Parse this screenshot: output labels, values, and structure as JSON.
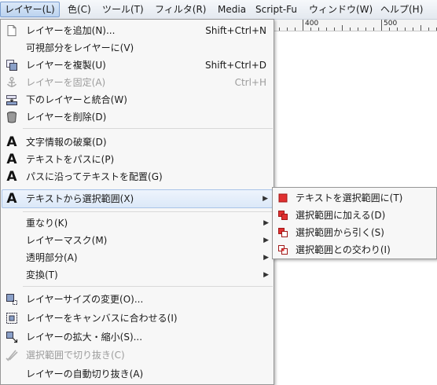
{
  "menubar": {
    "items": [
      {
        "label": "レイヤー(L)",
        "active": true
      },
      {
        "label": "色(C)"
      },
      {
        "label": "ツール(T)"
      },
      {
        "label": "フィルタ(R)"
      },
      {
        "label": "Media"
      },
      {
        "label": "Script-Fu"
      },
      {
        "label": "ウィンドウ(W)"
      },
      {
        "label": "ヘルプ(H)"
      }
    ]
  },
  "ruler": {
    "labels": [
      "400",
      "500"
    ]
  },
  "layer_menu": {
    "items": [
      {
        "label": "レイヤーを追加(N)...",
        "shortcut": "Shift+Ctrl+N",
        "icon": "new-layer-icon"
      },
      {
        "label": "可視部分をレイヤーに(V)"
      },
      {
        "label": "レイヤーを複製(U)",
        "shortcut": "Shift+Ctrl+D",
        "icon": "duplicate-layer-icon"
      },
      {
        "label": "レイヤーを固定(A)",
        "shortcut": "Ctrl+H",
        "icon": "anchor-icon",
        "disabled": true
      },
      {
        "label": "下のレイヤーと統合(W)",
        "icon": "merge-down-icon"
      },
      {
        "label": "レイヤーを削除(D)",
        "icon": "trash-icon"
      },
      {
        "label": "文字情報の破棄(D)",
        "icon": "text-tool-icon"
      },
      {
        "label": "テキストをパスに(P)",
        "icon": "text-tool-icon"
      },
      {
        "label": "パスに沿ってテキストを配置(G)",
        "icon": "text-tool-icon"
      },
      {
        "label": "テキストから選択範囲(X)",
        "icon": "text-tool-icon",
        "submenu": true
      },
      {
        "label": "重なり(K)",
        "submenu": true
      },
      {
        "label": "レイヤーマスク(M)",
        "submenu": true
      },
      {
        "label": "透明部分(A)",
        "submenu": true
      },
      {
        "label": "変換(T)",
        "submenu": true
      },
      {
        "label": "レイヤーサイズの変更(O)...",
        "icon": "layer-boundary-icon"
      },
      {
        "label": "レイヤーをキャンバスに合わせる(I)",
        "icon": "layer-to-canvas-icon"
      },
      {
        "label": "レイヤーの拡大・縮小(S)...",
        "icon": "scale-layer-icon"
      },
      {
        "label": "選択範囲で切り抜き(C)",
        "icon": "crop-icon",
        "disabled": true
      },
      {
        "label": "レイヤーの自動切り抜き(A)"
      }
    ]
  },
  "submenu": {
    "items": [
      {
        "label": "テキストを選択範囲に(T)",
        "icon": "selection-replace-icon"
      },
      {
        "label": "選択範囲に加える(D)",
        "icon": "selection-add-icon"
      },
      {
        "label": "選択範囲から引く(S)",
        "icon": "selection-subtract-icon"
      },
      {
        "label": "選択範囲との交わり(I)",
        "icon": "selection-intersect-icon"
      }
    ]
  },
  "colors": {
    "highlight_border": "#a9c4e8",
    "selection_red": "#e03030"
  }
}
